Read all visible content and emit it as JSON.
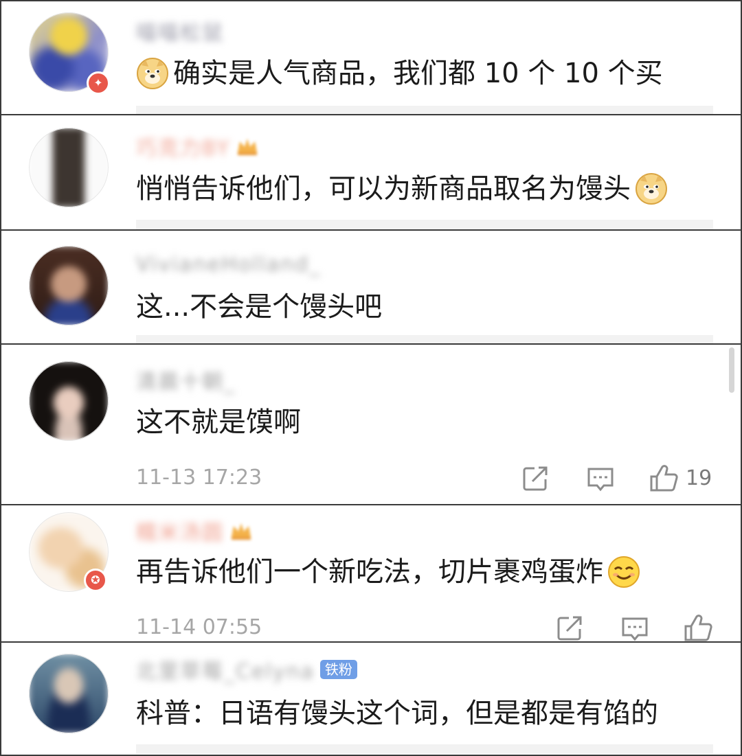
{
  "comments": [
    {
      "text": "确实是人气商品，我们都 10 个 10 个买",
      "username": "喵喵松鼠",
      "user_suffix": "",
      "has_emoji": true
    },
    {
      "text": "悄悄告诉他们，可以为新商品取名为馒头",
      "username": "巧克力BY",
      "user_suffix": "",
      "has_emoji": true
    },
    {
      "text": "这...不会是个馒头吧",
      "username": "VivianeHolland_",
      "user_suffix": ""
    },
    {
      "text": "这不就是馍啊",
      "username": "清晨十朝_",
      "time": "11-13 17:23",
      "likes": "19"
    },
    {
      "text": "再告诉他们一个新吃法，切片裹鸡蛋炸",
      "username": "糯米汤圆",
      "time": "11-14 07:55",
      "has_emoji": true
    },
    {
      "text": "科普：日语有馒头这个词，但是都是有馅的",
      "username": "北里草莓_Celyna",
      "fan_badge": "铁粉"
    }
  ]
}
